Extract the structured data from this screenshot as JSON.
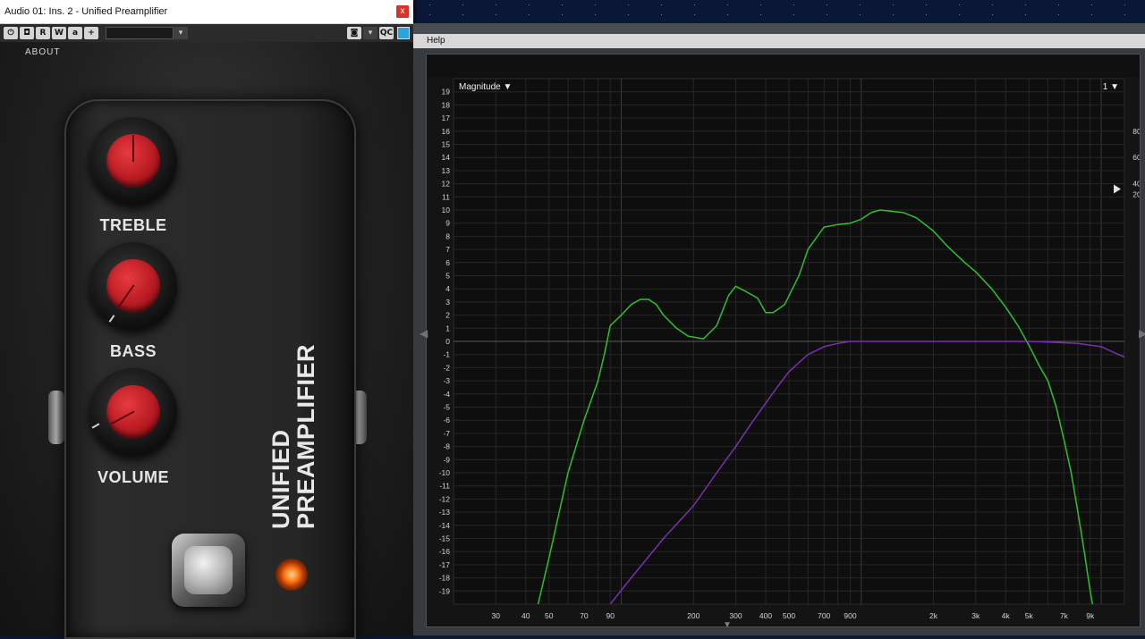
{
  "plugin": {
    "title": "Audio 01: Ins. 2 - Unified Preamplifier",
    "close_label": "x",
    "toolbar": {
      "power": "⏻",
      "bypass": "◘",
      "read": "R",
      "write": "W",
      "compare": "a",
      "add": "+",
      "qc": "QC",
      "camera": "◙",
      "dropdown": "▾"
    },
    "about_label": "ABOUT",
    "knobs": [
      {
        "label": "TREBLE"
      },
      {
        "label": "BASS"
      },
      {
        "label": "VOLUME"
      }
    ],
    "brand_line1": "UNIFIED",
    "brand_line2": "PREAMPLIFIER",
    "colors": {
      "knob_cap": "#c6202a",
      "led": "#ff7a1a",
      "pedal": "#262626"
    }
  },
  "analyzer": {
    "menu": [
      "Help"
    ],
    "display_mode": "Magnitude ▼",
    "channel": "1 ▼",
    "chart_data": {
      "type": "line",
      "title": "",
      "xscale": "log",
      "xlim": [
        20,
        12500
      ],
      "ylim": [
        -20,
        20
      ],
      "y_ticks": [
        19,
        18,
        17,
        16,
        15,
        14,
        13,
        12,
        11,
        10,
        9,
        8,
        7,
        6,
        5,
        4,
        3,
        2,
        1,
        0,
        -1,
        -2,
        -3,
        -4,
        -5,
        -6,
        -7,
        -8,
        -9,
        -10,
        -11,
        -12,
        -13,
        -14,
        -15,
        -16,
        -17,
        -18,
        -19
      ],
      "right_ticks": [
        {
          "label": "80",
          "at": 16
        },
        {
          "label": "60",
          "at": 14
        },
        {
          "label": "40",
          "at": 12
        },
        {
          "label": "20",
          "at": 12
        }
      ],
      "x_ticks": [
        {
          "label": "30",
          "value": 30
        },
        {
          "label": "40",
          "value": 40
        },
        {
          "label": "50",
          "value": 50
        },
        {
          "label": "70",
          "value": 70
        },
        {
          "label": "90",
          "value": 90
        },
        {
          "label": "200",
          "value": 200
        },
        {
          "label": "300",
          "value": 300
        },
        {
          "label": "400",
          "value": 400
        },
        {
          "label": "500",
          "value": 500
        },
        {
          "label": "700",
          "value": 700
        },
        {
          "label": "900",
          "value": 900
        },
        {
          "label": "2k",
          "value": 2000
        },
        {
          "label": "3k",
          "value": 3000
        },
        {
          "label": "4k",
          "value": 4000
        },
        {
          "label": "5k",
          "value": 5000
        },
        {
          "label": "7k",
          "value": 7000
        },
        {
          "label": "9k",
          "value": 9000
        }
      ],
      "grid": true,
      "series": [
        {
          "color": "#2fbf2f",
          "points": [
            [
              45,
              -20
            ],
            [
              50,
              -16.5
            ],
            [
              60,
              -10
            ],
            [
              70,
              -6
            ],
            [
              80,
              -3
            ],
            [
              85,
              -1
            ],
            [
              90,
              1.2
            ],
            [
              100,
              2
            ],
            [
              110,
              2.8
            ],
            [
              120,
              3.2
            ],
            [
              130,
              3.2
            ],
            [
              140,
              2.8
            ],
            [
              150,
              2
            ],
            [
              170,
              1
            ],
            [
              190,
              0.4
            ],
            [
              220,
              0.2
            ],
            [
              250,
              1.2
            ],
            [
              280,
              3.5
            ],
            [
              300,
              4.2
            ],
            [
              330,
              3.8
            ],
            [
              370,
              3.3
            ],
            [
              400,
              2.2
            ],
            [
              430,
              2.2
            ],
            [
              480,
              2.8
            ],
            [
              550,
              5
            ],
            [
              600,
              7
            ],
            [
              700,
              8.7
            ],
            [
              800,
              8.9
            ],
            [
              900,
              9
            ],
            [
              1000,
              9.3
            ],
            [
              1100,
              9.8
            ],
            [
              1200,
              10
            ],
            [
              1350,
              9.9
            ],
            [
              1500,
              9.8
            ],
            [
              1700,
              9.4
            ],
            [
              2000,
              8.4
            ],
            [
              2300,
              7.2
            ],
            [
              2700,
              6
            ],
            [
              3000,
              5.3
            ],
            [
              3500,
              4
            ],
            [
              4000,
              2.6
            ],
            [
              4500,
              1.2
            ],
            [
              5000,
              -0.3
            ],
            [
              5500,
              -1.8
            ],
            [
              6000,
              -3
            ],
            [
              6500,
              -5
            ],
            [
              7000,
              -7.5
            ],
            [
              7500,
              -10
            ],
            [
              8000,
              -13
            ],
            [
              8500,
              -16
            ],
            [
              9000,
              -19
            ],
            [
              9200,
              -20
            ]
          ]
        },
        {
          "color": "#7a2fb0",
          "points": [
            [
              90,
              -20
            ],
            [
              110,
              -18
            ],
            [
              150,
              -15
            ],
            [
              200,
              -12.5
            ],
            [
              250,
              -10
            ],
            [
              300,
              -8
            ],
            [
              350,
              -6.2
            ],
            [
              400,
              -4.7
            ],
            [
              450,
              -3.4
            ],
            [
              500,
              -2.3
            ],
            [
              600,
              -1
            ],
            [
              700,
              -0.4
            ],
            [
              800,
              -0.15
            ],
            [
              900,
              0
            ],
            [
              1500,
              0
            ],
            [
              3000,
              0
            ],
            [
              5000,
              0
            ],
            [
              6000,
              -0.05
            ],
            [
              8000,
              -0.15
            ],
            [
              10000,
              -0.4
            ],
            [
              12500,
              -1.2
            ]
          ]
        }
      ]
    }
  }
}
